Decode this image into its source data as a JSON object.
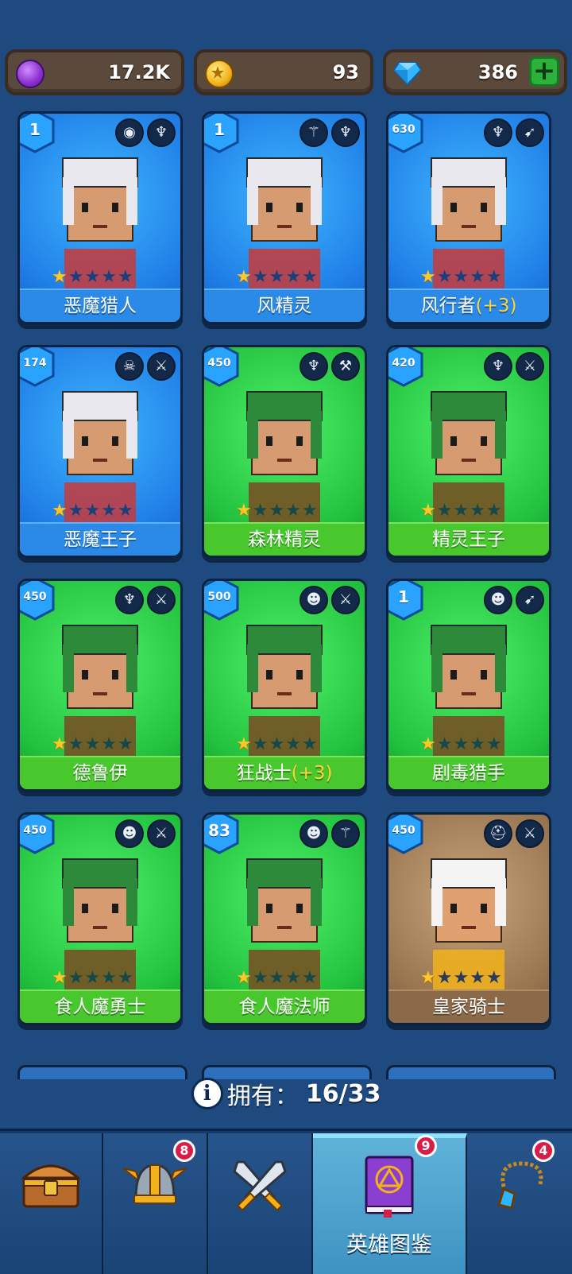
{
  "currency": {
    "gems_purple": "17.2K",
    "gold": "93",
    "diamonds": "386",
    "plus_label": "+"
  },
  "heroes": [
    {
      "name": "恶魔猎人",
      "bonus": "",
      "level": "1",
      "stars": 1,
      "theme": "blue",
      "roles": [
        "eye-icon",
        "elf-icon"
      ]
    },
    {
      "name": "风精灵",
      "bonus": "",
      "level": "1",
      "stars": 1,
      "theme": "blue",
      "roles": [
        "wand-icon",
        "elf-icon"
      ]
    },
    {
      "name": "风行者",
      "bonus": "(+3)",
      "level": "630",
      "stars": 1,
      "theme": "blue",
      "roles": [
        "elf-icon",
        "bow-icon"
      ]
    },
    {
      "name": "恶魔王子",
      "bonus": "",
      "level": "174",
      "stars": 1,
      "theme": "blue",
      "roles": [
        "demon-skull-icon",
        "dagger-icon"
      ]
    },
    {
      "name": "森林精灵",
      "bonus": "",
      "level": "450",
      "stars": 1,
      "theme": "green",
      "roles": [
        "elf-icon",
        "hammer-icon"
      ]
    },
    {
      "name": "精灵王子",
      "bonus": "",
      "level": "420",
      "stars": 1,
      "theme": "green",
      "roles": [
        "elf-icon",
        "dagger-icon"
      ]
    },
    {
      "name": "德鲁伊",
      "bonus": "",
      "level": "450",
      "stars": 1,
      "theme": "green",
      "roles": [
        "elf-icon",
        "sword-icon"
      ]
    },
    {
      "name": "狂战士",
      "bonus": "(+3)",
      "level": "500",
      "stars": 1,
      "theme": "green",
      "roles": [
        "orc-icon",
        "sword-icon"
      ]
    },
    {
      "name": "剧毒猎手",
      "bonus": "",
      "level": "1",
      "stars": 1,
      "theme": "green",
      "roles": [
        "orc-icon",
        "bow-icon"
      ]
    },
    {
      "name": "食人魔勇士",
      "bonus": "",
      "level": "450",
      "stars": 1,
      "theme": "green",
      "roles": [
        "orc-icon",
        "sword-icon"
      ]
    },
    {
      "name": "食人魔法师",
      "bonus": "",
      "level": "83",
      "stars": 1,
      "theme": "green",
      "roles": [
        "orc-icon",
        "wand-icon"
      ]
    },
    {
      "name": "皇家骑士",
      "bonus": "",
      "level": "450",
      "stars": 1,
      "theme": "brown",
      "roles": [
        "helmet-icon",
        "sword-icon"
      ]
    }
  ],
  "collection": {
    "label": "拥有：",
    "value": "16/33"
  },
  "nav": [
    {
      "name": "chest",
      "label": "",
      "badge": "",
      "active": false
    },
    {
      "name": "helmet",
      "label": "",
      "badge": "8",
      "active": false
    },
    {
      "name": "battle",
      "label": "",
      "badge": "",
      "active": false
    },
    {
      "name": "hero-book",
      "label": "英雄图鉴",
      "badge": "9",
      "active": true
    },
    {
      "name": "amulet",
      "label": "",
      "badge": "4",
      "active": false
    }
  ],
  "colors": {
    "background": "#1f4a80",
    "card_blue": "#1f7ee6",
    "card_green": "#22c23e",
    "card_brown": "#9a7650",
    "bonus_yellow": "#ffd43a",
    "badge_red": "#d81e48"
  }
}
